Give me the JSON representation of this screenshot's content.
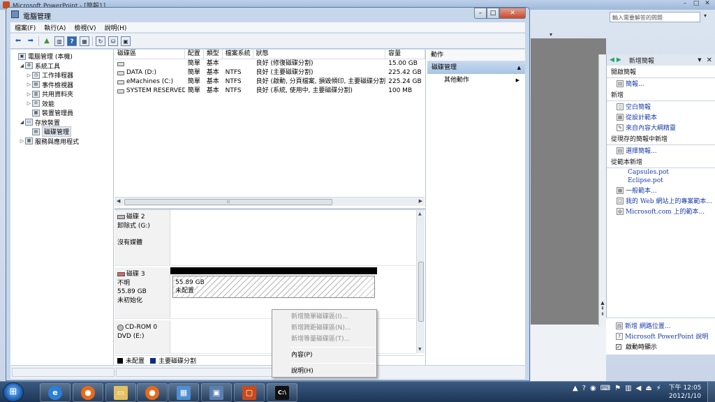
{
  "background_app": {
    "title": "Microsoft PowerPoint - [簡報1]",
    "help_box_placeholder": "輸入需要解答的問題",
    "task_pane": {
      "title": "新增簡報",
      "sections": [
        {
          "heading": "開啟簡報",
          "items": [
            {
              "icon": "folder-icon",
              "label": "簡報..."
            }
          ]
        },
        {
          "heading": "新增",
          "items": [
            {
              "icon": "blank-doc-icon",
              "label": "空白簡報"
            },
            {
              "icon": "template-icon",
              "label": "從設計範本"
            },
            {
              "icon": "outline-icon",
              "label": "來自內容大綱精靈"
            }
          ]
        },
        {
          "heading": "從現存的簡報中新增",
          "items": [
            {
              "icon": "choose-doc-icon",
              "label": "選擇簡報..."
            }
          ]
        },
        {
          "heading": "從範本新增",
          "items": [
            {
              "icon": "",
              "label": "Capsules.pot"
            },
            {
              "icon": "",
              "label": "Eclipse.pot"
            },
            {
              "icon": "general-template-icon",
              "label": "一般範本..."
            },
            {
              "icon": "web-template-icon",
              "label": "我的 Web 網站上的專案範本..."
            },
            {
              "icon": "globe-icon",
              "label": "Microsoft.com 上的範本..."
            }
          ]
        }
      ],
      "bottom": {
        "add_network": "新增 網路位置...",
        "help": "Microsoft PowerPoint 說明",
        "show_on_startup": "啟動時顯示"
      }
    }
  },
  "window": {
    "title": "電腦管理",
    "menu": [
      "檔案(F)",
      "執行(A)",
      "檢視(V)",
      "說明(H)"
    ]
  },
  "tree": [
    {
      "label": "電腦管理 (本機)",
      "level": 0,
      "arrow": ""
    },
    {
      "label": "系統工具",
      "level": 1,
      "arrow": "◢"
    },
    {
      "label": "工作排程器",
      "level": 2,
      "arrow": "▷"
    },
    {
      "label": "事件檢視器",
      "level": 2,
      "arrow": "▷"
    },
    {
      "label": "共用資料夾",
      "level": 2,
      "arrow": "▷"
    },
    {
      "label": "效能",
      "level": 2,
      "arrow": "▷"
    },
    {
      "label": "裝置管理員",
      "level": 2,
      "arrow": ""
    },
    {
      "label": "存放裝置",
      "level": 1,
      "arrow": "◢"
    },
    {
      "label": "磁碟管理",
      "level": 2,
      "arrow": "",
      "selected": true
    },
    {
      "label": "服務與應用程式",
      "level": 1,
      "arrow": "▷"
    }
  ],
  "volume_table": {
    "headers": [
      "磁碟區",
      "配置",
      "類型",
      "檔案系統",
      "狀態",
      "容量"
    ],
    "rows": [
      [
        "",
        "簡單",
        "基本",
        "",
        "良好 (修復磁碟分割)",
        "15.00 GB"
      ],
      [
        "DATA (D:)",
        "簡單",
        "基本",
        "NTFS",
        "良好 (主要磁碟分割)",
        "225.42 GB"
      ],
      [
        "eMachines (C:)",
        "簡單",
        "基本",
        "NTFS",
        "良好 (啟動, 分頁檔案, 損毀傾印, 主要磁碟分割)",
        "225.24 GB"
      ],
      [
        "SYSTEM RESERVED",
        "簡單",
        "基本",
        "NTFS",
        "良好 (系統, 使用中, 主要磁碟分割)",
        "100 MB"
      ]
    ]
  },
  "disks": [
    {
      "name": "磁碟 2",
      "lines": [
        "卸除式 (G:)",
        "",
        "沒有媒體"
      ]
    },
    {
      "name": "磁碟 3",
      "lines": [
        "不明",
        "55.89 GB",
        "未初始化"
      ],
      "partition": {
        "size": "55.89 GB",
        "status": "未配置"
      }
    },
    {
      "name": "CD-ROM 0",
      "lines": [
        "DVD (E:)"
      ]
    }
  ],
  "legend": [
    {
      "label": "未配置",
      "color": "#000000"
    },
    {
      "label": "主要磁碟分割",
      "color": "#0b2a8c"
    }
  ],
  "actions": {
    "header": "動作",
    "group": "磁碟管理",
    "items": [
      "其他動作"
    ]
  },
  "context_menu": [
    {
      "label": "新增簡單磁碟區(I)...",
      "disabled": true
    },
    {
      "label": "新增跨距磁碟區(N)...",
      "disabled": true
    },
    {
      "label": "新增等量磁碟區(T)...",
      "disabled": true
    },
    {
      "separator": true
    },
    {
      "label": "內容(P)",
      "disabled": false
    },
    {
      "separator": true
    },
    {
      "label": "說明(H)",
      "disabled": false
    }
  ],
  "taskbar": {
    "clock_time": "下午 12:05",
    "clock_date": "2012/1/10",
    "buttons": [
      "internet-explorer-icon",
      "firefox-icon",
      "file-explorer-icon",
      "firefox-icon",
      "control-panel-icon",
      "computer-management-icon",
      "powerpoint-icon",
      "command-prompt-icon"
    ]
  }
}
